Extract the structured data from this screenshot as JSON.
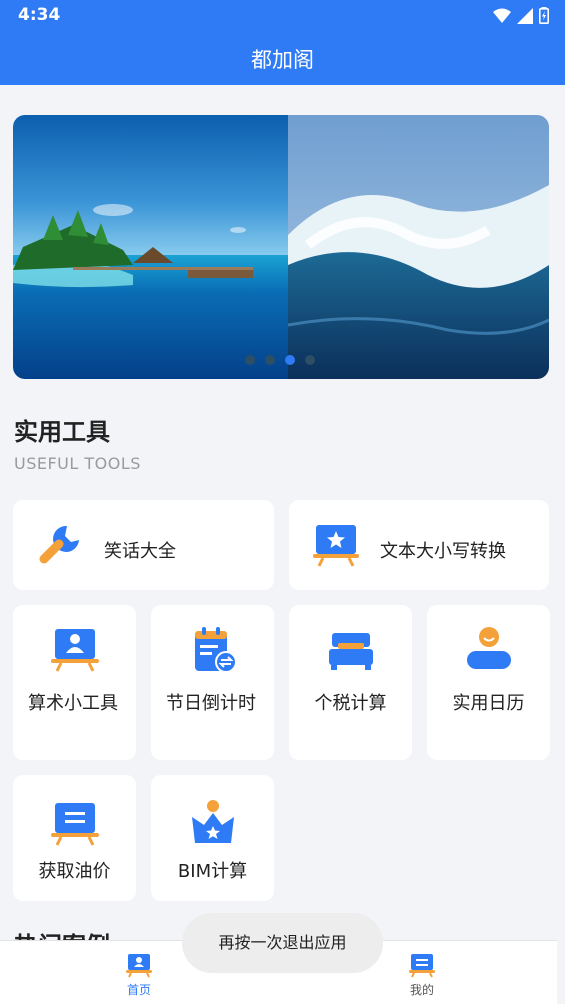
{
  "status_bar": {
    "time": "4:34",
    "icons": [
      "wifi-icon",
      "signal-icon",
      "battery-charging-icon"
    ]
  },
  "app_bar": {
    "title": "都加阁"
  },
  "banner": {
    "pages": 4,
    "active_index": 2,
    "images": [
      "tropical-island",
      "ocean-wave"
    ]
  },
  "section": {
    "title": "实用工具",
    "subtitle": "USEFUL TOOLS"
  },
  "tools_wide": [
    {
      "label": "笑话大全",
      "icon": "wrench-icon"
    },
    {
      "label": "文本大小写转换",
      "icon": "star-board-icon"
    }
  ],
  "tools_small": [
    {
      "label": "算术小工具",
      "icon": "person-board-icon"
    },
    {
      "label": "节日倒计时",
      "icon": "calendar-exchange-icon"
    },
    {
      "label": "个税计算",
      "icon": "bed-icon"
    },
    {
      "label": "实用日历",
      "icon": "person-icon"
    },
    {
      "label": "获取油价",
      "icon": "list-board-icon"
    },
    {
      "label": "BIM计算",
      "icon": "crown-star-icon"
    }
  ],
  "next_section_partial": "热门案例",
  "bottom_nav": [
    {
      "label": "首页",
      "icon": "home-person-icon",
      "active": true
    },
    {
      "label": "我的",
      "icon": "profile-board-icon",
      "active": false
    }
  ],
  "toast": "再按一次退出应用",
  "colors": {
    "primary": "#2f7bf6",
    "accent_orange": "#f5a13a",
    "inactive": "#555555"
  }
}
